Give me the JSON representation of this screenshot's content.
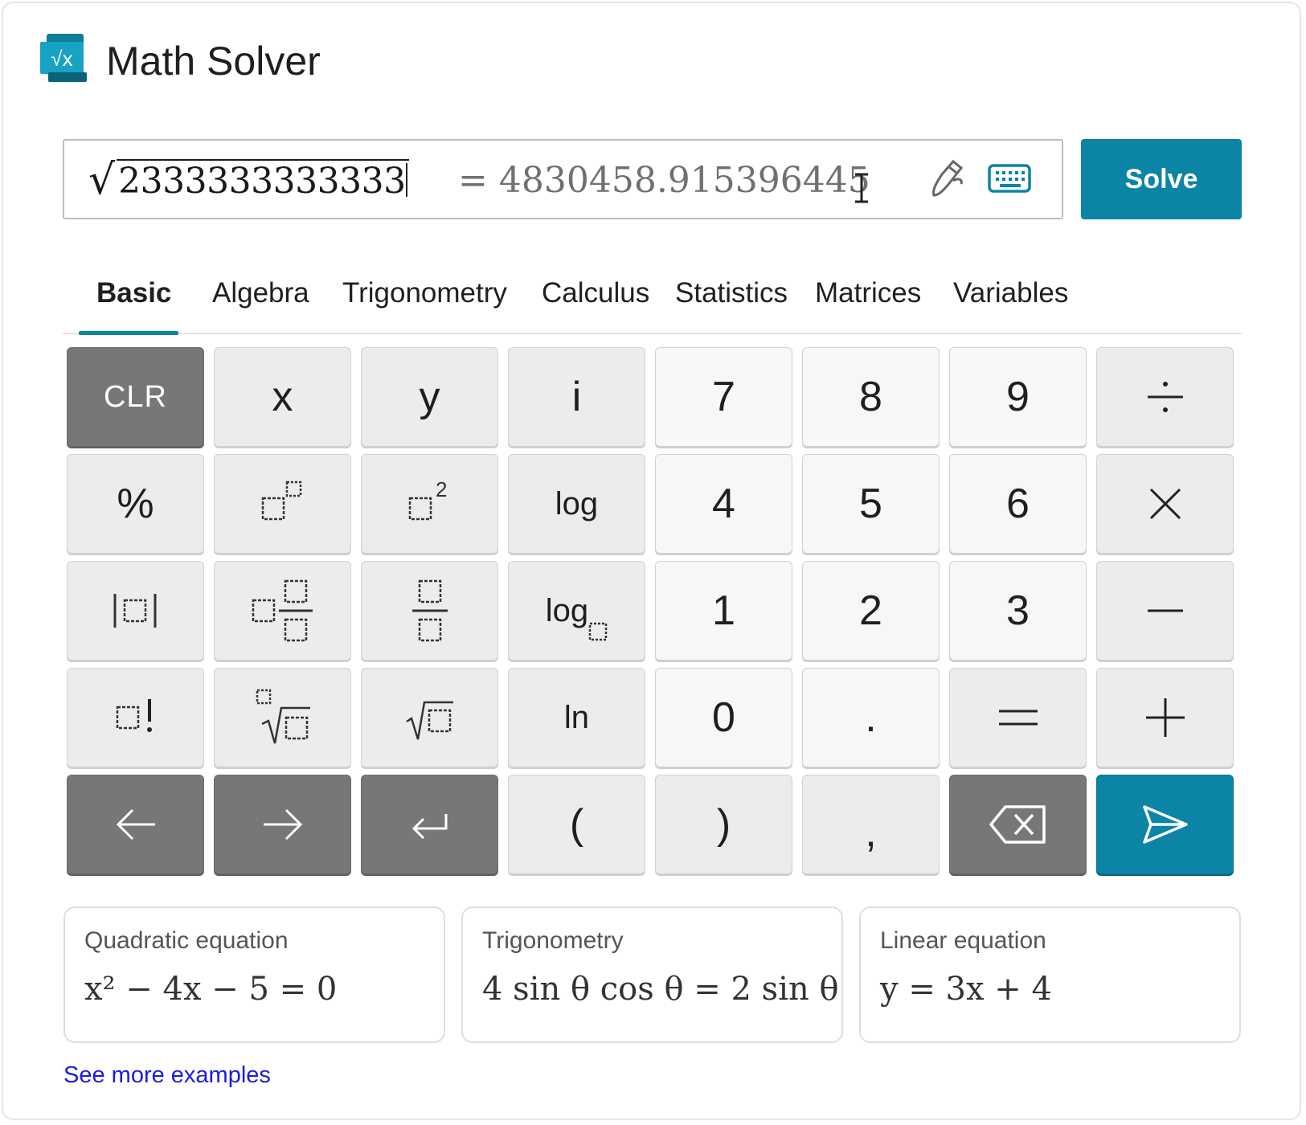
{
  "app": {
    "title": "Math Solver",
    "logo_icon": "sqrt-x-logo-icon"
  },
  "input": {
    "expression": "2333333333333",
    "expression_prefix": "√",
    "result": "= 4830458.915396445",
    "pen_icon": "pen-icon",
    "keyboard_icon": "keyboard-icon"
  },
  "solve_label": "Solve",
  "tabs": [
    {
      "label": "Basic",
      "active": true
    },
    {
      "label": "Algebra"
    },
    {
      "label": "Trigonometry"
    },
    {
      "label": "Calculus"
    },
    {
      "label": "Statistics"
    },
    {
      "label": "Matrices"
    },
    {
      "label": "Variables"
    }
  ],
  "keys": [
    [
      "CLR",
      "x",
      "y",
      "i",
      "7",
      "8",
      "9",
      "÷"
    ],
    [
      "%",
      "□^□",
      "□²",
      "log",
      "4",
      "5",
      "6",
      "×"
    ],
    [
      "|□|",
      "□ □/□",
      "□/□",
      "log□",
      "1",
      "2",
      "3",
      "−"
    ],
    [
      "□!",
      "□√□",
      "√□",
      "ln",
      "0",
      ".",
      "=",
      "+"
    ],
    [
      "←",
      "→",
      "↵",
      "(",
      ")",
      ",",
      "⌫",
      "▷"
    ]
  ],
  "key_labels": {
    "clr": "CLR",
    "x": "x",
    "y": "y",
    "i": "i",
    "seven": "7",
    "eight": "8",
    "nine": "9",
    "percent": "%",
    "log": "log",
    "four": "4",
    "five": "5",
    "six": "6",
    "one": "1",
    "two": "2",
    "three": "3",
    "ln": "ln",
    "zero": "0",
    "dot": ".",
    "equals": "=",
    "open_paren": "(",
    "close_paren": ")",
    "comma": ","
  },
  "examples": [
    {
      "title": "Quadratic equation",
      "equation": "x² − 4x − 5 = 0"
    },
    {
      "title": "Trigonometry",
      "equation": "4 sin θ cos θ = 2 sin θ"
    },
    {
      "title": "Linear equation",
      "equation": "y = 3x + 4"
    }
  ],
  "see_more_label": "See more examples",
  "colors": {
    "accent": "#0b84a5",
    "dark_key": "#777777",
    "link": "#1a1ae6"
  }
}
